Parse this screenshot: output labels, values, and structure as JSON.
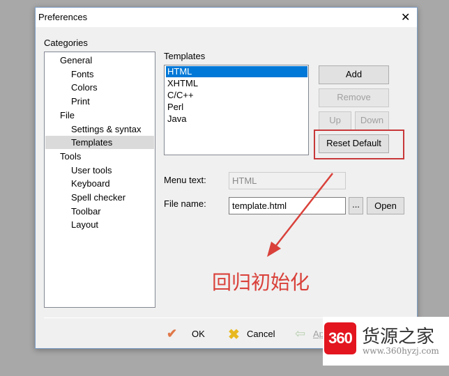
{
  "window": {
    "title": "Preferences",
    "close": "✕"
  },
  "categories": {
    "label": "Categories",
    "items": [
      {
        "label": "General",
        "level": 0
      },
      {
        "label": "Fonts",
        "level": 1
      },
      {
        "label": "Colors",
        "level": 1
      },
      {
        "label": "Print",
        "level": 1
      },
      {
        "label": "File",
        "level": 0
      },
      {
        "label": "Settings & syntax",
        "level": 1
      },
      {
        "label": "Templates",
        "level": 1,
        "selected": true
      },
      {
        "label": "Tools",
        "level": 0
      },
      {
        "label": "User tools",
        "level": 1
      },
      {
        "label": "Keyboard",
        "level": 1
      },
      {
        "label": "Spell checker",
        "level": 1
      },
      {
        "label": "Toolbar",
        "level": 1
      },
      {
        "label": "Layout",
        "level": 1
      }
    ]
  },
  "templates": {
    "label": "Templates",
    "items": [
      "HTML",
      "XHTML",
      "C/C++",
      "Perl",
      "Java"
    ],
    "selected": "HTML"
  },
  "buttons": {
    "add": "Add",
    "remove": "Remove",
    "up": "Up",
    "down": "Down",
    "reset": "Reset Default",
    "browse": "...",
    "open": "Open"
  },
  "fields": {
    "menu_text_label": "Menu text:",
    "menu_text_value": "HTML",
    "file_name_label": "File name:",
    "file_name_value": "template.html"
  },
  "annotation": {
    "text": "回归初始化",
    "color": "#d9413a"
  },
  "footer": {
    "ok": "OK",
    "cancel": "Cancel",
    "apply": "Apply"
  },
  "watermark": {
    "logo": "360",
    "name": "货源之家",
    "url": "www.360hyzj.com"
  },
  "colors": {
    "selection": "#0078d7",
    "highlight_box": "#c8383a"
  }
}
